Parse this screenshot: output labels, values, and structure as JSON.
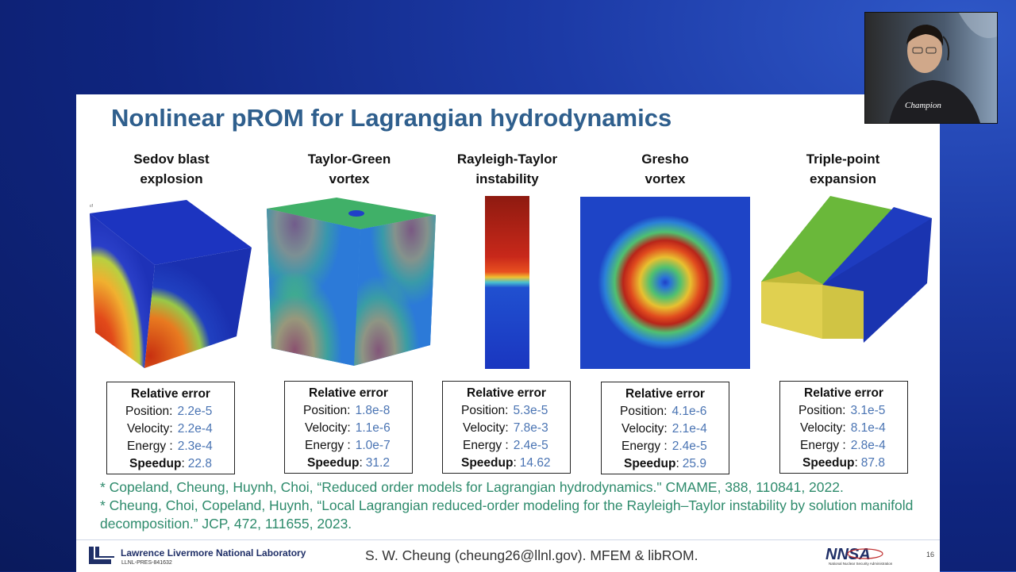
{
  "slide": {
    "title": "Nonlinear pROM for Lagrangian hydrodynamics",
    "panels": [
      {
        "title_line1": "Sedov blast",
        "title_line2": "explosion",
        "error_heading": "Relative error",
        "position_label": "Position:",
        "position": "2.2e-5",
        "velocity_label": "Velocity:",
        "velocity": "2.2e-4",
        "energy_label": "Energy  :",
        "energy": "2.3e-4",
        "speedup_label": "Speedup",
        "speedup": "22.8"
      },
      {
        "title_line1": "Taylor-Green",
        "title_line2": "vortex",
        "error_heading": "Relative error",
        "position_label": "Position:",
        "position": "1.8e-8",
        "velocity_label": "Velocity:",
        "velocity": "1.1e-6",
        "energy_label": "Energy  :",
        "energy": "1.0e-7",
        "speedup_label": "Speedup",
        "speedup": "31.2"
      },
      {
        "title_line1": "Rayleigh-Taylor",
        "title_line2": "instability",
        "error_heading": "Relative error",
        "position_label": "Position:",
        "position": "5.3e-5",
        "velocity_label": "Velocity:",
        "velocity": "7.8e-3",
        "energy_label": "Energy  :",
        "energy": "2.4e-5",
        "speedup_label": "Speedup",
        "speedup": "14.62"
      },
      {
        "title_line1": "Gresho",
        "title_line2": "vortex",
        "error_heading": "Relative error",
        "position_label": "Position:",
        "position": "4.1e-6",
        "velocity_label": "Velocity:",
        "velocity": "2.1e-4",
        "energy_label": "Energy  :",
        "energy": "2.4e-5",
        "speedup_label": "Speedup",
        "speedup": "25.9"
      },
      {
        "title_line1": "Triple-point",
        "title_line2": "expansion",
        "error_heading": "Relative error",
        "position_label": "Position:",
        "position": "3.1e-5",
        "velocity_label": "Velocity:",
        "velocity": "8.1e-4",
        "energy_label": "Energy  :",
        "energy": "2.8e-4",
        "speedup_label": "Speedup",
        "speedup": "87.8"
      }
    ],
    "references": [
      "* Copeland, Cheung, Huynh, Choi, “Reduced order models for Lagrangian hydrodynamics.\" CMAME, 388, 110841, 2022.",
      "* Cheung, Choi, Copeland, Huynh, “Local Lagrangian reduced-order modeling for the Rayleigh–Taylor instability by solution manifold decomposition.” JCP, 472, 111655, 2023."
    ],
    "footer": {
      "lab_name": "Lawrence Livermore National Laboratory",
      "lab_code": "LLNL-PRES-841632",
      "center_text": "S. W. Cheung (cheung26@llnl.gov). MFEM & libROM.",
      "nnsa_name": "National Nuclear Security Administration",
      "page_number": "16"
    }
  },
  "webcam": {
    "shirt_text": "Champion"
  },
  "colors": {
    "title": "#2f5f8d",
    "values": "#4a74b3",
    "references": "#2e8b6c",
    "background": "#0f2580"
  }
}
